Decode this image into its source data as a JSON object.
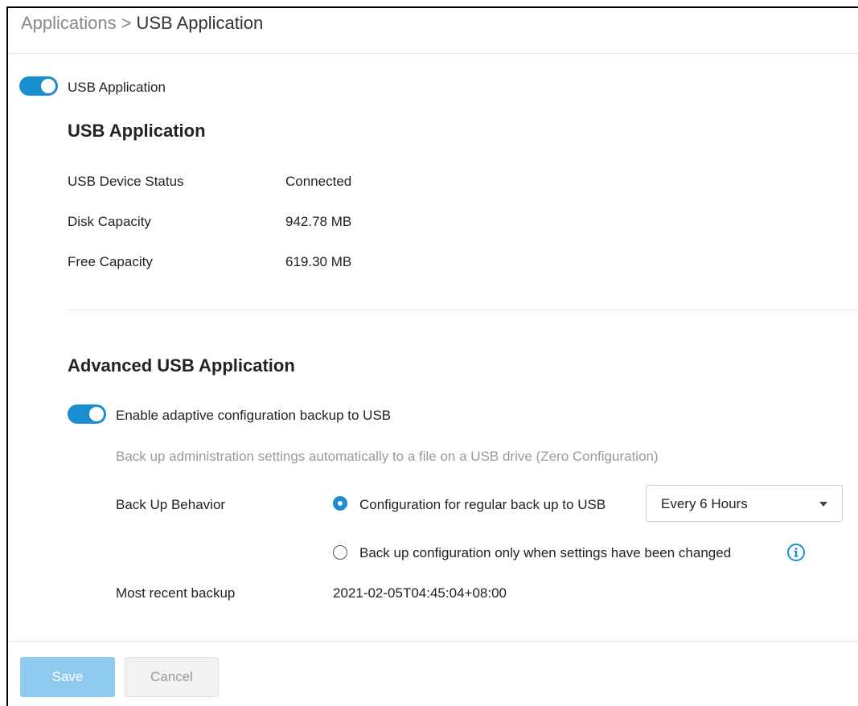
{
  "breadcrumb": {
    "parent": "Applications",
    "separator": ">",
    "current": "USB Application"
  },
  "main_toggle": {
    "label": "USB Application",
    "enabled": true
  },
  "usb_section": {
    "title": "USB Application",
    "rows": [
      {
        "label": "USB Device Status",
        "value": "Connected"
      },
      {
        "label": "Disk Capacity",
        "value": "942.78 MB"
      },
      {
        "label": "Free Capacity",
        "value": "619.30 MB"
      }
    ]
  },
  "advanced": {
    "title": "Advanced USB Application",
    "toggle_label": "Enable adaptive configuration backup to USB",
    "toggle_enabled": true,
    "description": "Back up administration settings automatically to a file on a USB drive (Zero Configuration)",
    "behavior_label": "Back Up Behavior",
    "option_regular": "Configuration for regular back up to USB",
    "option_changed": "Back up configuration only when settings have been changed",
    "selected_option": "regular",
    "interval_selected": "Every 6 Hours",
    "recent_label": "Most recent backup",
    "recent_value": "2021-02-05T04:45:04+08:00"
  },
  "footer": {
    "save_label": "Save",
    "cancel_label": "Cancel"
  },
  "colors": {
    "accent": "#1a8ed1",
    "save_disabled": "#8fcbef"
  }
}
